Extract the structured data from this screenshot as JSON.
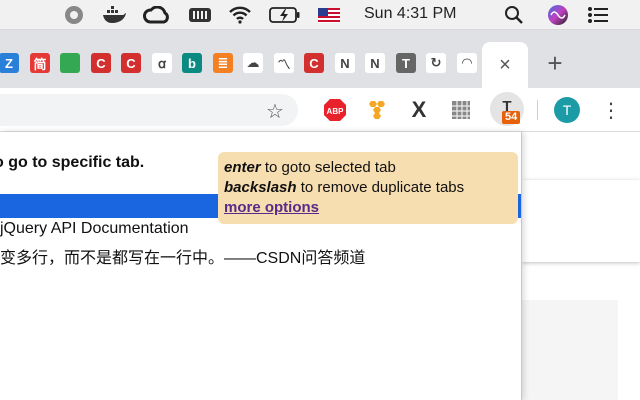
{
  "menubar": {
    "clock": "Sun 4:31 PM"
  },
  "tabs": {
    "favicons": [
      {
        "label": "Z",
        "color": "#2a7fd8"
      },
      {
        "label": "简",
        "color": "#e53935"
      },
      {
        "label": "",
        "color": "#34a853"
      },
      {
        "label": "C",
        "color": "#d32f2f"
      },
      {
        "label": "C",
        "color": "#d32f2f"
      },
      {
        "label": "ꭤ",
        "color": "#ffffff"
      },
      {
        "label": "b",
        "color": "#0a8a80"
      },
      {
        "label": "≣",
        "color": "#f48024"
      },
      {
        "label": "☁",
        "color": "#ffffff"
      },
      {
        "label": "〽",
        "color": "#ffffff"
      },
      {
        "label": "C",
        "color": "#d32f2f"
      },
      {
        "label": "N",
        "color": "#ffffff"
      },
      {
        "label": "N",
        "color": "#ffffff"
      },
      {
        "label": "T",
        "color": "#666666"
      },
      {
        "label": "↻",
        "color": "#ffffff"
      },
      {
        "label": "◠",
        "color": "#ffffff"
      }
    ],
    "close_label": "×",
    "new_tab_label": "+"
  },
  "toolbar": {
    "star": "☆",
    "extensions": {
      "abp": "ABP",
      "x": "X",
      "t": "T",
      "t_badge": "54",
      "profile": "T"
    },
    "menu": "⋮"
  },
  "popup": {
    "heading": "o go to specific tab.",
    "rows": [
      "jQuery API Documentation",
      "变多行，而不是都写在一行中。——CSDN问答频道"
    ],
    "hint": {
      "enter_key": "enter",
      "enter_text": " to goto selected tab",
      "backslash_key": "backslash",
      "backslash_text": " to remove duplicate tabs",
      "more_options": "more options"
    }
  }
}
